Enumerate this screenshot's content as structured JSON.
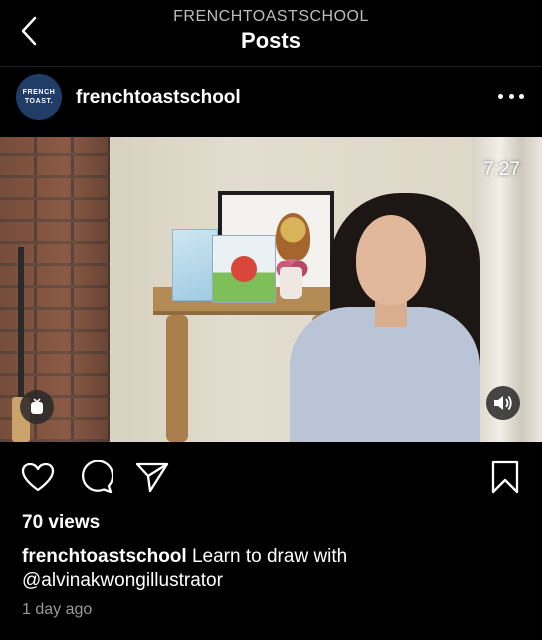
{
  "header": {
    "subtitle": "FRENCHTOASTSCHOOL",
    "title": "Posts"
  },
  "post": {
    "avatar_lines": [
      "FRENCH",
      "TOAST."
    ],
    "username": "frenchtoastschool",
    "video_duration": "7:27",
    "views": "70 views",
    "caption_user": "frenchtoastschool",
    "caption_text": " Learn to draw with @alvinakwongillustrator",
    "time_ago": "1 day ago"
  },
  "icons": {
    "back": "chevron-left-icon",
    "more": "more-horizontal-icon",
    "igtv": "igtv-icon",
    "sound": "speaker-icon",
    "like": "heart-icon",
    "comment": "comment-icon",
    "share": "send-icon",
    "save": "bookmark-icon"
  },
  "colors": {
    "background": "#000000",
    "text": "#ffffff",
    "muted": "#9a9a9a",
    "avatar": "#1f3d66"
  }
}
